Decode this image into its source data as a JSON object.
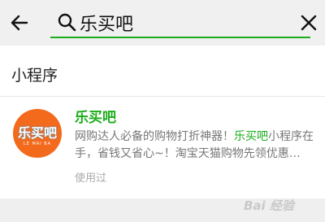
{
  "search": {
    "query": "乐买吧",
    "back_icon": "arrow-left-icon",
    "search_icon": "magnifier-icon",
    "clear_icon": "close-icon",
    "accent_color": "#1aad19"
  },
  "section": {
    "title": "小程序"
  },
  "result": {
    "logo_text": "乐买吧",
    "logo_subtext": "LE  MAI  BA",
    "name": "乐买吧",
    "desc_part1": "网购达人必备的购物打折神器！",
    "desc_highlight": "乐买吧",
    "desc_part2": "小程序在手，省钱又省心~！淘宝天猫购物先领优惠…",
    "used_label": "使用过"
  },
  "watermark": {
    "text": "Bai 经验"
  }
}
